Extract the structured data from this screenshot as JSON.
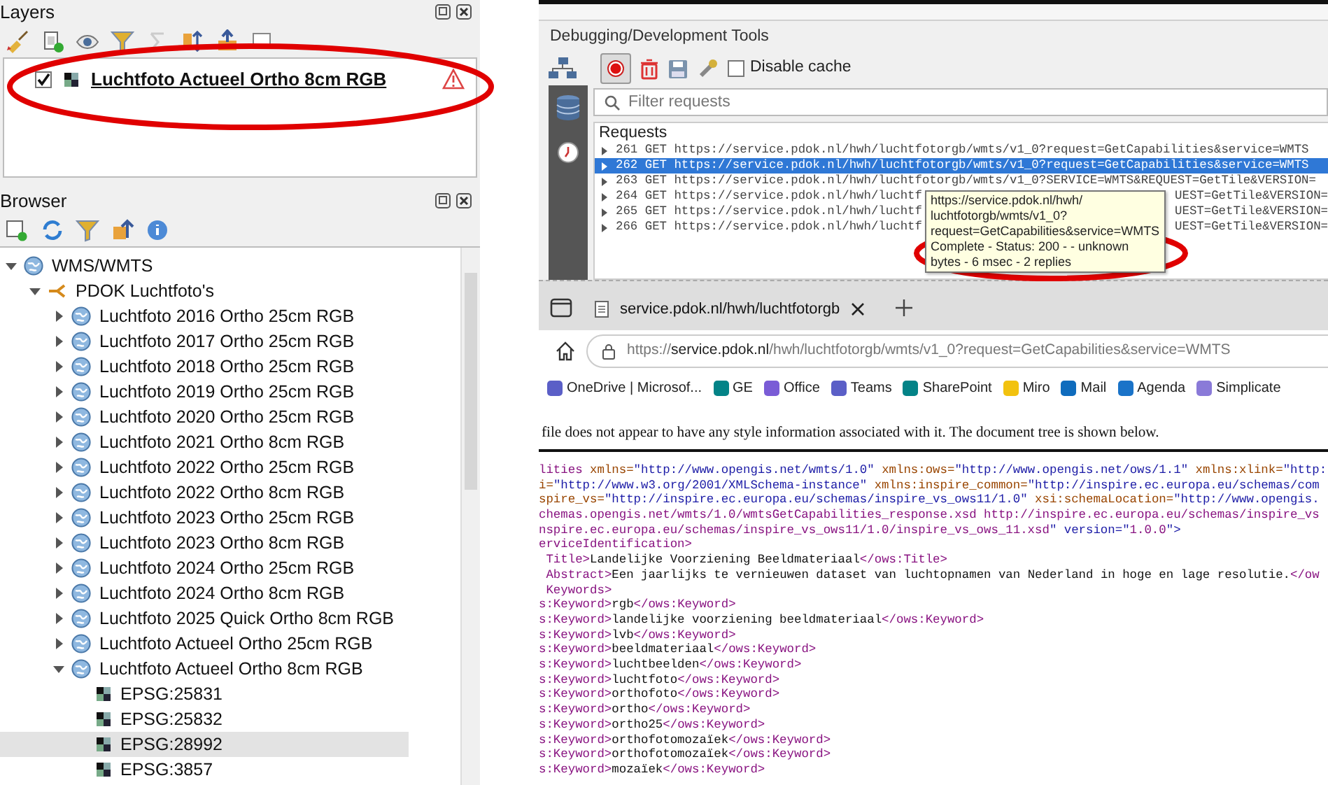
{
  "layers_panel": {
    "title": "Layers",
    "layers": [
      {
        "name": "Luchtfoto Actueel Ortho 8cm RGB",
        "checked": true
      }
    ]
  },
  "browser_panel": {
    "title": "Browser",
    "tree": [
      {
        "label": "WMS/WMTS",
        "kind": "service",
        "expanded": true,
        "children": [
          {
            "label": "PDOK Luchtfoto's",
            "kind": "connection",
            "expanded": true,
            "children": [
              {
                "label": "Luchtfoto 2016 Ortho 25cm RGB",
                "kind": "layer",
                "expanded": false
              },
              {
                "label": "Luchtfoto 2017 Ortho 25cm RGB",
                "kind": "layer",
                "expanded": false
              },
              {
                "label": "Luchtfoto 2018 Ortho 25cm RGB",
                "kind": "layer",
                "expanded": false
              },
              {
                "label": "Luchtfoto 2019 Ortho 25cm RGB",
                "kind": "layer",
                "expanded": false
              },
              {
                "label": "Luchtfoto 2020 Ortho 25cm RGB",
                "kind": "layer",
                "expanded": false
              },
              {
                "label": "Luchtfoto 2021 Ortho 8cm RGB",
                "kind": "layer",
                "expanded": false
              },
              {
                "label": "Luchtfoto 2022 Ortho 25cm RGB",
                "kind": "layer",
                "expanded": false
              },
              {
                "label": "Luchtfoto 2022 Ortho 8cm RGB",
                "kind": "layer",
                "expanded": false
              },
              {
                "label": "Luchtfoto 2023 Ortho 25cm RGB",
                "kind": "layer",
                "expanded": false
              },
              {
                "label": "Luchtfoto 2023 Ortho 8cm RGB",
                "kind": "layer",
                "expanded": false
              },
              {
                "label": "Luchtfoto 2024 Ortho 25cm RGB",
                "kind": "layer",
                "expanded": false
              },
              {
                "label": "Luchtfoto 2024 Ortho 8cm RGB",
                "kind": "layer",
                "expanded": false
              },
              {
                "label": "Luchtfoto 2025 Quick Ortho 8cm RGB",
                "kind": "layer",
                "expanded": false
              },
              {
                "label": "Luchtfoto Actueel Ortho 25cm RGB",
                "kind": "layer",
                "expanded": false
              },
              {
                "label": "Luchtfoto Actueel Ortho 8cm RGB",
                "kind": "layer",
                "expanded": true,
                "children": [
                  {
                    "label": "EPSG:25831",
                    "kind": "crs",
                    "selected": false
                  },
                  {
                    "label": "EPSG:25832",
                    "kind": "crs",
                    "selected": false
                  },
                  {
                    "label": "EPSG:28992",
                    "kind": "crs",
                    "selected": true
                  },
                  {
                    "label": "EPSG:3857",
                    "kind": "crs",
                    "selected": false
                  }
                ]
              }
            ]
          }
        ]
      }
    ]
  },
  "dev_tools": {
    "title": "Debugging/Development Tools",
    "recording": true,
    "disable_cache": {
      "label": "Disable cache",
      "checked": false
    },
    "filter": {
      "placeholder": "Filter requests"
    },
    "requests_label": "Requests",
    "requests": [
      {
        "text": "261 GET https://service.pdok.nl/hwh/luchtfotorgb/wmts/v1_0?request=GetCapabilities&service=WMTS",
        "selected": false
      },
      {
        "text": "262 GET https://service.pdok.nl/hwh/luchtfotorgb/wmts/v1_0?request=GetCapabilities&service=WMTS",
        "selected": true
      },
      {
        "text": "263 GET https://service.pdok.nl/hwh/luchtfotorgb/wmts/v1_0?SERVICE=WMTS&REQUEST=GetTile&VERSION=",
        "selected": false
      },
      {
        "text": "264 GET https://service.pdok.nl/hwh/luchtf",
        "text_after": "UEST=GetTile&VERSION=",
        "selected": false
      },
      {
        "text": "265 GET https://service.pdok.nl/hwh/luchtf",
        "text_after": "UEST=GetTile&VERSION=",
        "selected": false
      },
      {
        "text": "266 GET https://service.pdok.nl/hwh/luchtf",
        "text_after": "UEST=GetTile&VERSION=",
        "selected": false
      }
    ],
    "tooltip": {
      "lines": [
        "https://service.pdok.nl/hwh/",
        "luchtfotorgb/wmts/v1_0?",
        "request=GetCapabilities&service=WMTS",
        "Complete - Status: 200 - - unknown",
        "bytes - 6 msec - 2 replies"
      ]
    }
  },
  "web_browser": {
    "tab": {
      "title": "service.pdok.nl/hwh/luchtfotorgb"
    },
    "address": {
      "scheme": "https://",
      "host": "service.pdok.nl",
      "path": "/hwh/luchtfotorgb/wmts/v1_0?request=GetCapabilities&service=WMTS"
    },
    "bookmarks": [
      {
        "label": "OneDrive | Microsof...",
        "color": "#5b5fc7"
      },
      {
        "label": "GE",
        "color": "#038387"
      },
      {
        "label": "Office",
        "color": "#7a5cd6"
      },
      {
        "label": "Teams",
        "color": "#5b5fc7"
      },
      {
        "label": "SharePoint",
        "color": "#038387"
      },
      {
        "label": "Miro",
        "color": "#f2c20f"
      },
      {
        "label": "Mail",
        "color": "#0f6cbd"
      },
      {
        "label": "Agenda",
        "color": "#1a73c8"
      },
      {
        "label": "Simplicate",
        "color": "#8a7ad8"
      }
    ],
    "document": {
      "notice": "file does not appear to have any style information associated with it. The document tree is shown below.",
      "lines": [
        "lities xmlns=\"http://www.opengis.net/wmts/1.0\" xmlns:ows=\"http://www.opengis.net/ows/1.1\" xmlns:xlink=\"http:",
        "i=\"http://www.w3.org/2001/XMLSchema-instance\" xmlns:inspire_common=\"http://inspire.ec.europa.eu/schemas/com",
        "spire_vs=\"http://inspire.ec.europa.eu/schemas/inspire_vs_ows11/1.0\" xsi:schemaLocation=\"http://www.opengis.",
        "chemas.opengis.net/wmts/1.0/wmtsGetCapabilities_response.xsd http://inspire.ec.europa.eu/schemas/inspire_vs",
        "nspire.ec.europa.eu/schemas/inspire_vs_ows11/1.0/inspire_vs_ows_11.xsd\" version=\"1.0.0\">",
        "erviceIdentification>",
        " Title>Landelijke Voorziening Beeldmateriaal</ows:Title>",
        " Abstract>Een jaarlijks te vernieuwen dataset van luchtopnamen van Nederland in hoge en lage resolutie.</ow",
        " Keywords>",
        "s:Keyword>rgb</ows:Keyword>",
        "s:Keyword>landelijke voorziening beeldmateriaal</ows:Keyword>",
        "s:Keyword>lvb</ows:Keyword>",
        "s:Keyword>beeldmateriaal</ows:Keyword>",
        "s:Keyword>luchtbeelden</ows:Keyword>",
        "s:Keyword>luchtfoto</ows:Keyword>",
        "s:Keyword>orthofoto</ows:Keyword>",
        "s:Keyword>ortho</ows:Keyword>",
        "s:Keyword>ortho25</ows:Keyword>",
        "s:Keyword>orthofotomozaïek</ows:Keyword>",
        "s:Keyword>orthofotomozaïek</ows:Keyword>",
        "s:Keyword>mozaïek</ows:Keyword>"
      ]
    }
  }
}
